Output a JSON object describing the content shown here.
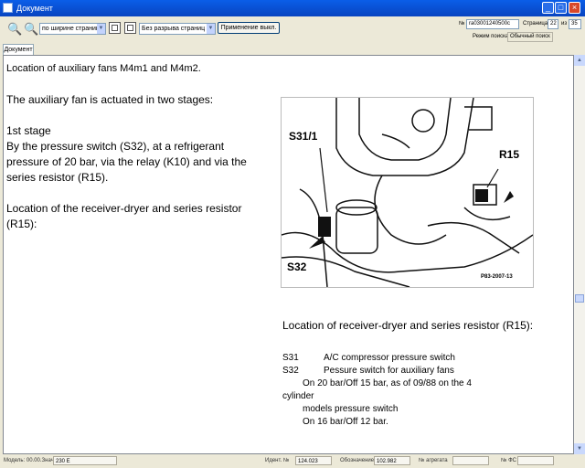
{
  "window": {
    "title": "Документ"
  },
  "toolbar": {
    "zoom_combo": "по ширине страницы",
    "break_combo": "Без разрыва страниц",
    "apply_button": "Применение выкл.",
    "doc_number_label": "№",
    "doc_number_value": "ra03001240500c",
    "page_label": "Страница",
    "page_current": "22",
    "page_of": "из",
    "page_total": "35",
    "search_mode_label": "Режим поиска",
    "search_mode_value": "Обычный поиск"
  },
  "tabs": [
    "Документ"
  ],
  "document": {
    "heading": "Location of auxiliary fans M4m1 and M4m2.",
    "intro": "The auxiliary fan is actuated in two stages:",
    "stage_title": "1st stage",
    "stage_text": "By the pressure switch (S32), at a refrigerant pressure of 20 bar, via the relay (K10) and via the series resistor (R15).",
    "location_text": "Location of the receiver-dryer and series resistor (R15):",
    "figure_labels": {
      "s31": "S31/1",
      "s32": "S32",
      "r15": "R15",
      "code": "P83-2007-13"
    },
    "caption": "Location of receiver-dryer and series resistor (R15):",
    "legend": [
      {
        "code": "S31",
        "text": "A/C compressor pressure switch"
      },
      {
        "code": "S32",
        "text": "Pessure switch for auxiliary fans"
      }
    ],
    "legend_notes": [
      "On 20 bar/Off 15 bar, as of 09/88 on the 4",
      "cylinder",
      "models pressure switch",
      "On 16 bar/Off 12 bar."
    ]
  },
  "statusbar": {
    "model_label": "Модель: 00.00.Значение",
    "model_value": "230 E",
    "ident_label": "Идент. №",
    "ident_value": "124.023",
    "sales_label": "Обозначение",
    "sales_value": "102.982",
    "other_label": "№ агрегата",
    "fg_label": "№ ФС"
  }
}
